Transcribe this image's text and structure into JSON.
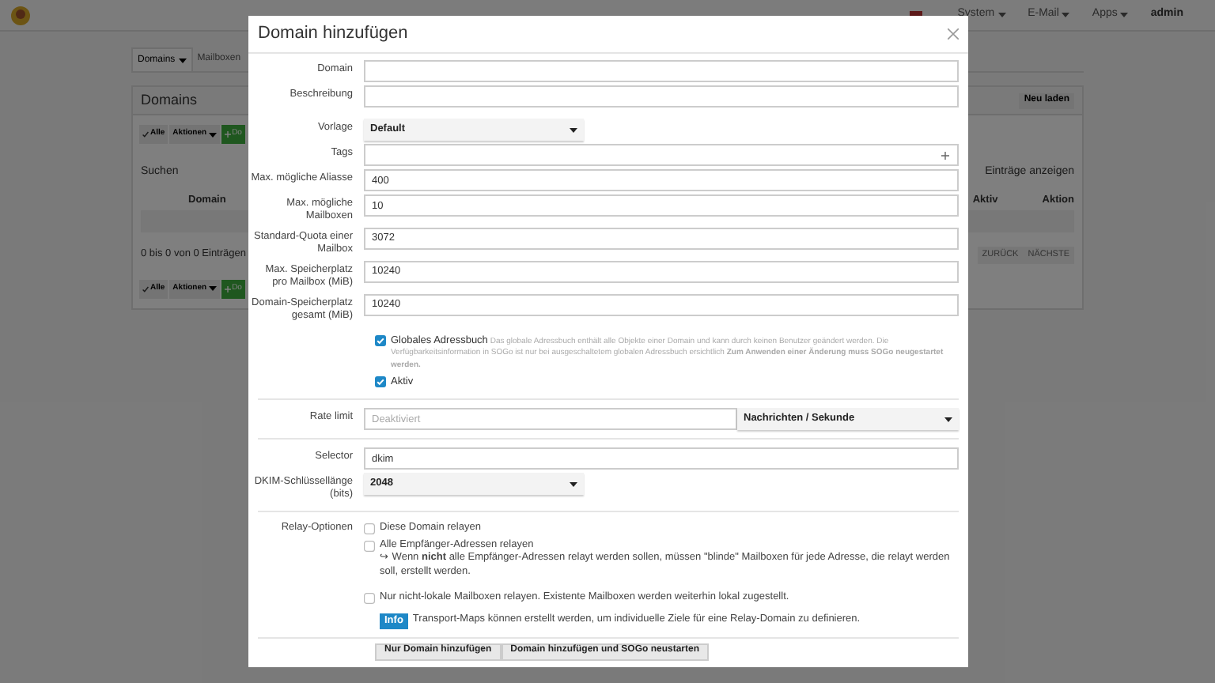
{
  "page": {
    "nav": [
      {
        "label": "System"
      },
      {
        "label": "E-Mail"
      },
      {
        "label": "Apps"
      }
    ],
    "user": "admin",
    "tabs": [
      {
        "label": "Domains",
        "selected": true
      },
      {
        "label": "Mailboxen",
        "selected": false
      }
    ],
    "panel": {
      "title": "Domains",
      "reload": "Neu laden",
      "toolbar": [
        {
          "kind": "check",
          "label": "Alle"
        },
        {
          "kind": "dropdown",
          "label": "Aktionen"
        },
        {
          "kind": "add",
          "label": "Do"
        }
      ],
      "search_label": "Suchen",
      "length_label": "Einträge anzeigen",
      "columns": [
        "Domain",
        "Aktiv",
        "Aktion"
      ],
      "info": "0 bis 0 von 0 Einträgen",
      "pager": [
        "ZURÜCK",
        "NÄCHSTE"
      ],
      "toolbar_bottom": [
        {
          "kind": "check",
          "label": "Alle"
        },
        {
          "kind": "dropdown",
          "label": "Aktionen"
        },
        {
          "kind": "add",
          "label": "Do"
        }
      ]
    }
  },
  "modal": {
    "title": "Domain hinzufügen",
    "fields": [
      {
        "label": "Domain",
        "kind": "input"
      },
      {
        "label": "Beschreibung",
        "kind": "input"
      },
      {
        "label": "Vorlage",
        "kind": "select",
        "value": "Default"
      },
      {
        "label": "Tags",
        "kind": "tags"
      },
      {
        "label": "Max. mögliche Aliasse",
        "kind": "input",
        "value": "400"
      },
      {
        "label": "Max. mögliche Mailboxen",
        "kind": "input",
        "value": "10"
      },
      {
        "label": "Standard-Quota einer Mailbox",
        "kind": "input",
        "value": "3072"
      },
      {
        "label": "Max. Speicherplatz pro Mailbox (MiB)",
        "kind": "input",
        "value": "10240"
      },
      {
        "label": "Domain-Speicherplatz gesamt (MiB)",
        "kind": "input",
        "value": "10240"
      }
    ],
    "checkboxes": [
      {
        "label": "Globales Adressbuch",
        "checked": true,
        "description": "Das globale Adressbuch enthält alle Objekte einer Domain und kann durch keinen Benutzer geändert werden. Die Verfügbarkeitsinformation in SOGo ist nur bei ausgeschaltetem globalen Adressbuch ersichtlich **Zum Anwenden einer Änderung muss SOGo neugestartet werden.**"
      },
      {
        "label": "Aktiv",
        "checked": true
      }
    ],
    "rate_limit": {
      "label": "Rate limit",
      "placeholder": "Deaktiviert",
      "unit": "Nachrichten / Sekunde"
    },
    "dkim": [
      {
        "label": "Selector",
        "kind": "input",
        "value": "dkim"
      },
      {
        "label": "DKIM-Schlüssellänge (bits)",
        "kind": "select",
        "value": "2048"
      }
    ],
    "relay": {
      "label": "Relay-Optionen",
      "options": [
        {
          "label": "Diese Domain relayen",
          "checked": false
        },
        {
          "label": "Alle Empfänger-Adressen relayen",
          "checked": false,
          "note": "↪ Wenn **nicht** alle Empfänger-Adressen relayt werden sollen, müssen \"blinde\" Mailboxen für jede Adresse, die relayt werden soll, erstellt werden."
        },
        {
          "label": "Nur nicht-lokale Mailboxen relayen. Existente Mailboxen werden weiterhin lokal zugestellt.",
          "checked": false
        }
      ],
      "info": {
        "badge": "Info",
        "text": "Transport-Maps können erstellt werden, um individuelle Ziele für eine Relay-Domain zu definieren."
      }
    },
    "buttons": [
      "Nur Domain hinzufügen",
      "Domain hinzufügen und SOGo neustarten"
    ]
  }
}
